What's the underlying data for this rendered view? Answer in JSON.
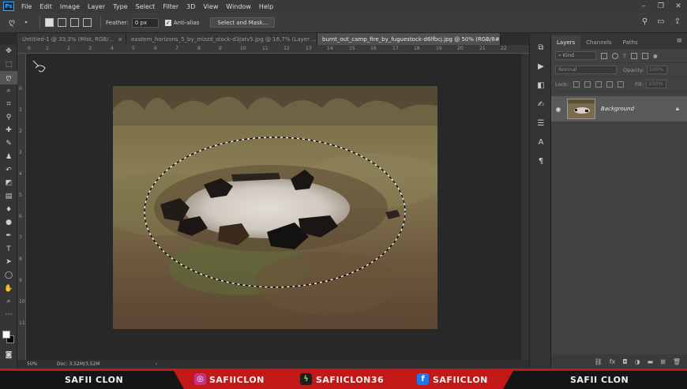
{
  "app": {
    "logo": "Ps",
    "menu": [
      "File",
      "Edit",
      "Image",
      "Layer",
      "Type",
      "Select",
      "Filter",
      "3D",
      "View",
      "Window",
      "Help"
    ]
  },
  "options": {
    "feather_label": "Feather:",
    "feather_value": "0 px",
    "antialias_label": "Anti-alias",
    "select_mask_label": "Select and Mask..."
  },
  "tabs": [
    {
      "label": "Untitled-1 @ 33,3% (Mist, RGB/...",
      "active": false
    },
    {
      "label": "eastern_horizons_5_by_mizzd_stock-d3jatv5.jpg @ 16,7% (Layer ...",
      "active": false
    },
    {
      "label": "burnt_out_camp_fire_by_fuguestock-d6lfbcj.jpg @ 50% (RGB/8#)",
      "active": true
    }
  ],
  "ruler_top": [
    "0",
    "1",
    "2",
    "3",
    "4",
    "5",
    "6",
    "7",
    "8",
    "9",
    "10",
    "11",
    "12",
    "13",
    "14",
    "15",
    "16",
    "17",
    "18",
    "19",
    "20",
    "21",
    "22"
  ],
  "ruler_left": [
    "0",
    "1",
    "2",
    "3",
    "4",
    "5",
    "6",
    "7",
    "8",
    "9",
    "10",
    "11",
    "12",
    "13",
    "14",
    "15"
  ],
  "status": {
    "zoom": "50%",
    "doc": "Doc: 3,52M/3,52M"
  },
  "panel": {
    "tabs": [
      "Layers",
      "Channels",
      "Paths"
    ],
    "kind_placeholder": "Kind",
    "blend_mode": "Normal",
    "opacity_label": "Opacity:",
    "opacity_value": "100%",
    "lock_label": "Lock:",
    "fill_label": "Fill:",
    "fill_value": "100%",
    "layer_name": "Background"
  },
  "banner": {
    "left": "SAFII CLON",
    "instagram": "SAFIICLON",
    "other": "SAFIICLON36",
    "facebook": "SAFIICLON",
    "right": "SAFII CLON"
  },
  "colors": {
    "accent_red": "#c21818",
    "ps_blue": "#31a8ff"
  }
}
